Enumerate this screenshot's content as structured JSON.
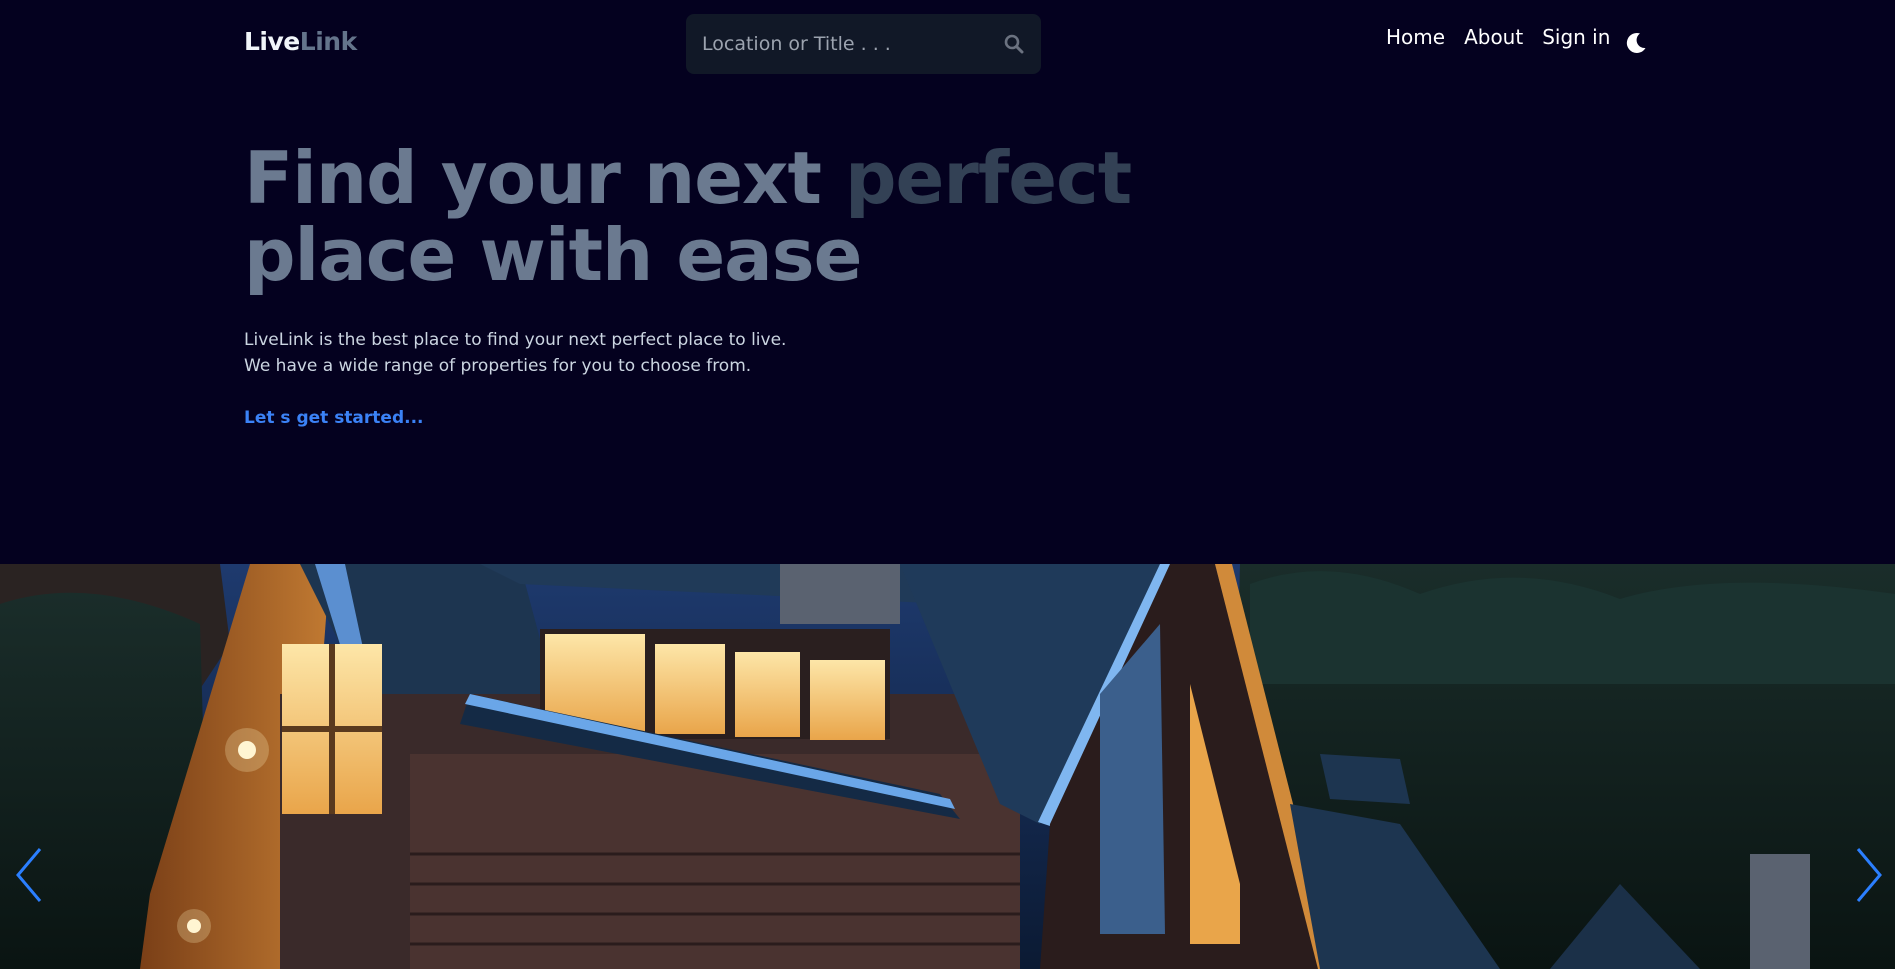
{
  "header": {
    "logo": {
      "part1": "Live",
      "part2": "Link"
    },
    "search": {
      "placeholder": "Location or Title . . ."
    },
    "nav": [
      {
        "label": "Home"
      },
      {
        "label": "About"
      },
      {
        "label": "Sign in"
      }
    ]
  },
  "hero": {
    "title_line1_a": "Find your next ",
    "title_line1_b": "perfect",
    "title_line2": "place with ease",
    "description_line1": "LiveLink is the best place to find your next perfect place to live.",
    "description_line2": "We have a wide range of properties for you to choose from.",
    "cta": "Let s get started..."
  },
  "icons": {
    "search": "search-icon",
    "theme": "moon-icon",
    "prev": "chevron-left-icon",
    "next": "chevron-right-icon"
  },
  "colors": {
    "background": "#04011f",
    "accent": "#3b82f6",
    "muted": "#64748b"
  }
}
